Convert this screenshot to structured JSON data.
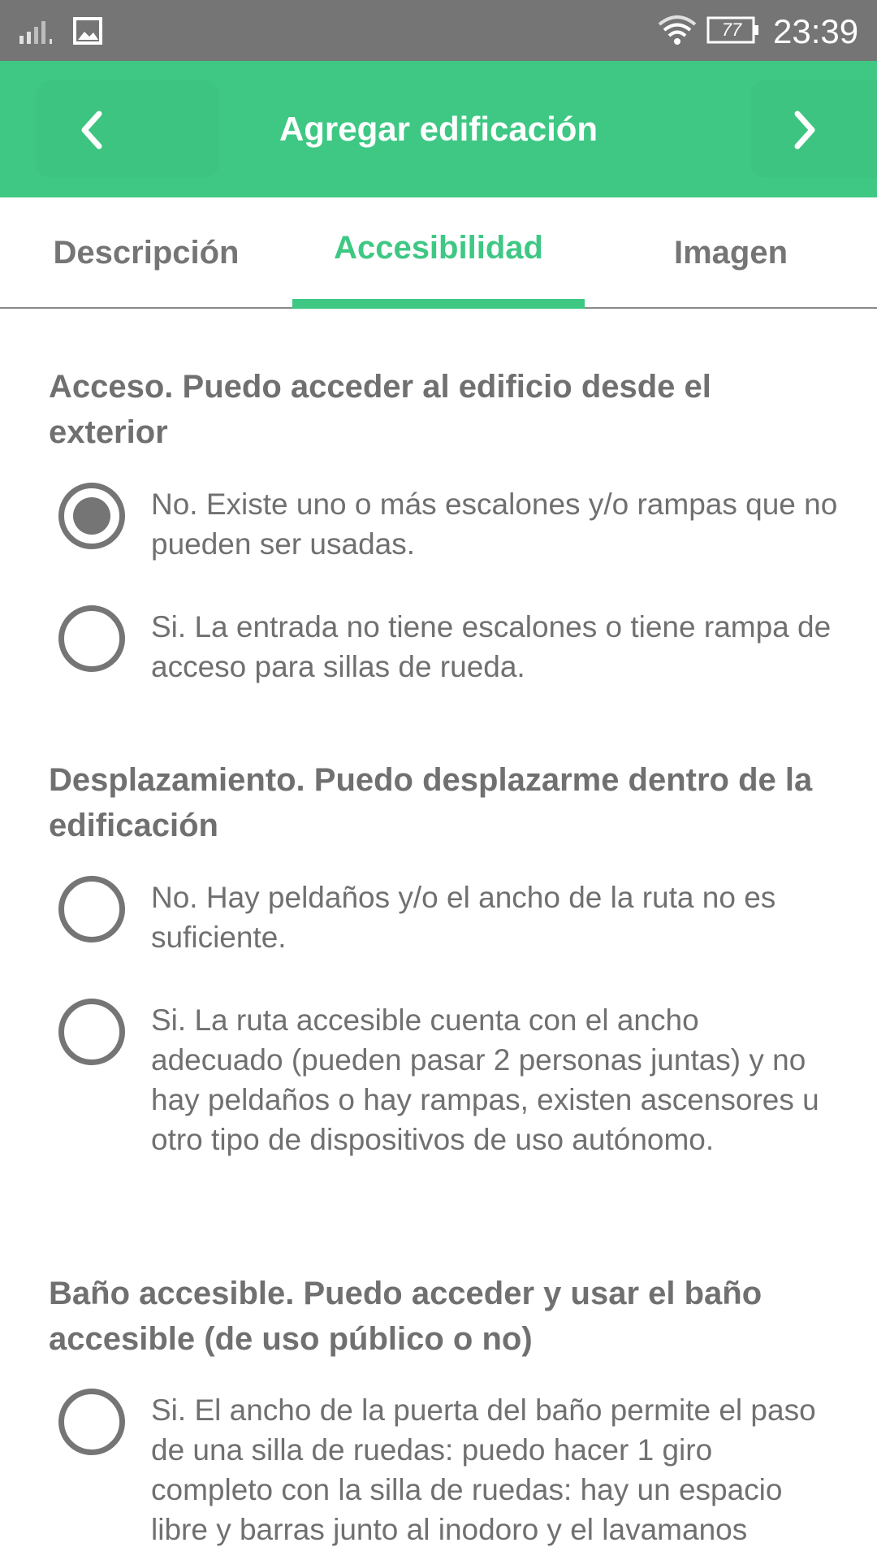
{
  "status_bar": {
    "time": "23:39",
    "battery_level": "77",
    "icons": [
      "signal-icon",
      "image-icon",
      "wifi-icon",
      "battery-icon"
    ]
  },
  "app_bar": {
    "title": "Agregar edificación",
    "back_icon": "chevron-left-icon",
    "forward_icon": "chevron-right-icon",
    "color": "#3ec884"
  },
  "tabs": [
    {
      "label": "Descripción",
      "active": false
    },
    {
      "label": "Accesibilidad",
      "active": true
    },
    {
      "label": "Imagen",
      "active": false
    }
  ],
  "questions": [
    {
      "title": "Acceso. Puedo acceder al edificio desde el exterior",
      "options": [
        {
          "text": "No. Existe uno o más escalones y/o rampas que no pueden ser usadas.",
          "selected": true
        },
        {
          "text": "Si. La entrada no tiene escalones o tiene rampa de acceso para sillas de rueda.",
          "selected": false
        }
      ]
    },
    {
      "title": "Desplazamiento. Puedo desplazarme dentro de la edificación",
      "options": [
        {
          "text": "No. Hay peldaños y/o el ancho de la ruta no es suficiente.",
          "selected": false
        },
        {
          "text": "Si. La ruta accesible cuenta con el ancho adecuado (pueden pasar 2 personas juntas) y no hay peldaños o hay rampas, existen ascensores u otro tipo de dispositivos de uso autónomo.",
          "selected": false
        }
      ]
    },
    {
      "title": "Baño accesible. Puedo acceder y usar el baño accesible (de uso público o no)",
      "options": [
        {
          "text": "Si. El ancho de la puerta del baño permite el paso de una silla de ruedas: puedo hacer 1 giro completo con la silla de ruedas: hay un espacio libre y barras junto al inodoro y el lavamanos",
          "selected": false
        }
      ]
    }
  ]
}
